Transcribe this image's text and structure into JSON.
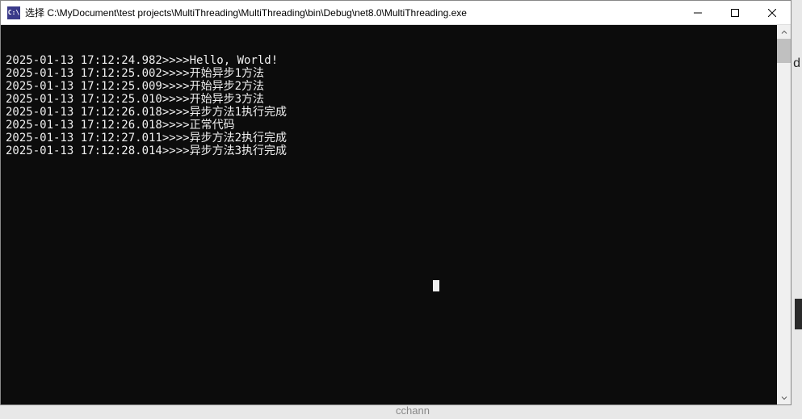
{
  "window": {
    "icon_text": "C:\\",
    "title": "选择 C:\\MyDocument\\test projects\\MultiThreading\\MultiThreading\\bin\\Debug\\net8.0\\MultiThreading.exe"
  },
  "console": {
    "lines": [
      "2025-01-13 17:12:24.982>>>>Hello, World!",
      "2025-01-13 17:12:25.002>>>>开始异步1方法",
      "2025-01-13 17:12:25.009>>>>开始异步2方法",
      "2025-01-13 17:12:25.010>>>>开始异步3方法",
      "2025-01-13 17:12:26.018>>>>异步方法1执行完成",
      "2025-01-13 17:12:26.018>>>>正常代码",
      "2025-01-13 17:12:27.011>>>>异步方法2执行完成",
      "2025-01-13 17:12:28.014>>>>异步方法3执行完成"
    ]
  },
  "background": {
    "fragment_d": "d",
    "fragment_bottom": "cchann"
  }
}
